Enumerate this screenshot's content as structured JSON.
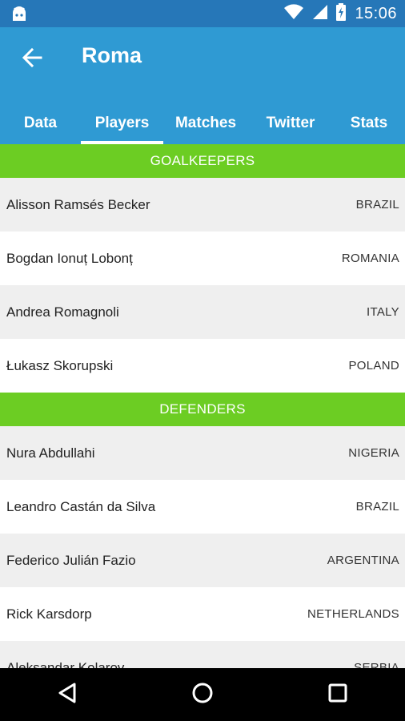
{
  "status_bar": {
    "time": "15:06",
    "icons": [
      "android-debug-icon",
      "wifi-icon",
      "signal-icon",
      "battery-charging-icon"
    ]
  },
  "app_bar": {
    "title": "Roma",
    "back_icon": "arrow-back-icon",
    "background": "#2f9ad3"
  },
  "tabs": [
    {
      "label": "Data",
      "selected": false
    },
    {
      "label": "Players",
      "selected": true
    },
    {
      "label": "Matches",
      "selected": false
    },
    {
      "label": "Twitter",
      "selected": false
    },
    {
      "label": "Stats",
      "selected": false
    }
  ],
  "sections": [
    {
      "header": "GOALKEEPERS",
      "players": [
        {
          "name": "Alisson Ramsés Becker",
          "country": "BRAZIL"
        },
        {
          "name": "Bogdan Ionuț Lobonț",
          "country": "ROMANIA"
        },
        {
          "name": "Andrea Romagnoli",
          "country": "ITALY"
        },
        {
          "name": "Łukasz Skorupski",
          "country": "POLAND"
        }
      ]
    },
    {
      "header": "DEFENDERS",
      "players": [
        {
          "name": "Nura Abdullahi",
          "country": "NIGERIA"
        },
        {
          "name": "Leandro Castán da Silva",
          "country": "BRAZIL"
        },
        {
          "name": "Federico Julián Fazio",
          "country": "ARGENTINA"
        },
        {
          "name": "Rick Karsdorp",
          "country": "NETHERLANDS"
        },
        {
          "name": "Aleksandar Kolarov",
          "country": "SERBIA"
        }
      ]
    }
  ],
  "colors": {
    "accent": "#2f9ad3",
    "section_header": "#6ccd23",
    "status_bar": "#2677b8"
  },
  "nav_bar": {
    "buttons": [
      "back-triangle-icon",
      "home-circle-icon",
      "recents-square-icon"
    ]
  }
}
